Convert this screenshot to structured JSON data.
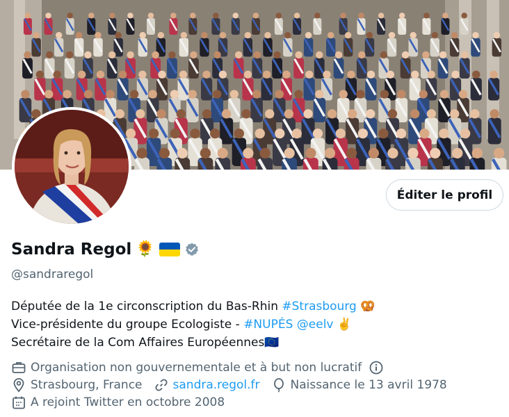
{
  "profile": {
    "name": "Sandra Regol",
    "name_emojis": "🌻",
    "handle": "@sandraregol",
    "edit_button": "Éditer le profil",
    "verified": true
  },
  "bio": {
    "line1_text": "Députée de la 1e circonscription du Bas-Rhin ",
    "line1_tag": "#Strasbourg",
    "line1_emoji": "🥨",
    "line2_text": "Vice-présidente du groupe Ecologiste - ",
    "line2_tag1": "#NUPÉS",
    "line2_tag2": "@eelv",
    "line2_emoji": "✌️",
    "line3_text": "Secrétaire de la Com Affaires Européennes",
    "line3_emoji": "🇪🇺"
  },
  "meta": {
    "category": "Organisation non gouvernementale et à but non lucratif",
    "location": "Strasbourg, France",
    "website": "sandra.regol.fr",
    "birthday": "Naissance le 13 avril 1978",
    "joined": "A rejoint Twitter en octobre 2008"
  },
  "colors": {
    "link": "#1d9bf0",
    "secondary_text": "#536471",
    "verified_badge": "#829aab",
    "ukraine_blue": "#0057b7",
    "ukraine_yellow": "#ffd700"
  }
}
